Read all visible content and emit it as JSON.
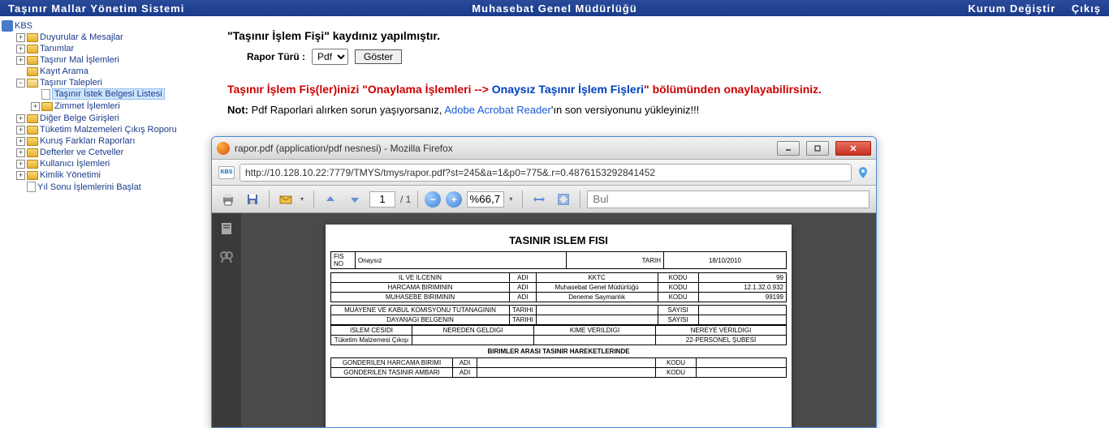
{
  "topbar": {
    "left": "Taşınır Mallar Yönetim Sistemi",
    "center": "Muhasebat Genel Müdürlüğü",
    "change_inst": "Kurum Değiştir",
    "logout": "Çıkış"
  },
  "tree": {
    "root": "KBS",
    "items": [
      "Duyurular & Mesajlar",
      "Tanımlar",
      "Taşınır Mal İşlemleri",
      "Kayıt Arama",
      "Taşınır Talepleri",
      "Diğer Belge Girişleri",
      "Tüketim Malzemeleri Çıkış Roporu",
      "Kuruş Farkları Raporları",
      "Defterler ve Cetveller",
      "Kullanıcı İşlemleri",
      "Kimlik Yönetimi",
      "Yıl Sonu İşlemlerini Başlat"
    ],
    "sub_talepleri": [
      "Taşınır İstek Belgesi Listesi",
      "Zimmet İşlemleri"
    ]
  },
  "content": {
    "saved_msg": "\"Taşınır İşlem Fişi\" kaydınız yapılmıştır.",
    "report_type_label": "Rapor Türü :",
    "report_type_value": "Pdf",
    "show_btn": "Göster",
    "line2_red1": "Taşınır İşlem Fiş(ler)inizi \"Onaylama İşlemleri --> ",
    "line2_blue": "Onaysız Taşınır İşlem Fişleri",
    "line2_red2": "\" bölümünden onaylayabilirsiniz.",
    "note_bold": "Not:",
    "note_text1": " Pdf Raporlari alırken sorun yaşıyorsanız, ",
    "note_link": "Adobe Acrobat Reader",
    "note_text2": "'ın son versiyonunu yükleyiniz!!!"
  },
  "popup": {
    "title": "rapor.pdf (application/pdf nesnesi) - Mozilla Firefox",
    "url": "http://10.128.10.22:7779/TMYS/tmys/rapor.pdf?st=245&a=1&p0=775&.r=0.4876153292841452",
    "favicon_text": "KBS",
    "page_current": "1",
    "page_total": "/ 1",
    "zoom": "%66,7",
    "find_placeholder": "Bul"
  },
  "pdf": {
    "title": "TASINIR ISLEM FISI",
    "r1": {
      "fisno_lab": "FIS NO",
      "fisno_val": "Onaysız",
      "tarih_lab": "TARIH",
      "tarih_val": "18/10/2010"
    },
    "r2": {
      "c1": "IL VE ILCENIN",
      "c2": "ADI",
      "c3": "KKTC",
      "c4": "KODU",
      "c5": "99"
    },
    "r3": {
      "c1": "HARCAMA BIRIMININ",
      "c2": "ADI",
      "c3": "Muhasebat Genel Müdürlüğü",
      "c4": "KODU",
      "c5": "12.1.32.0.932"
    },
    "r4": {
      "c1": "MUHASEBE BIRIMININ",
      "c2": "ADI",
      "c3": "Deneme Saymanlık",
      "c4": "KODU",
      "c5": "99199"
    },
    "r5": {
      "c1": "MUAYENE VE KABUL KOMISYONU TUTANAGININ",
      "c2": "TARIHI",
      "c3": "",
      "c4": "SAYISI",
      "c5": ""
    },
    "r6": {
      "c1": "DAYANAGI BELGENIN",
      "c2": "TARIHI",
      "c3": "",
      "c4": "SAYISI",
      "c5": ""
    },
    "r7": {
      "c1": "ISLEM CESIDI",
      "c2": "NEREDEN GELDIGI",
      "c3": "KIME VERILDIGI",
      "c4": "NEREYE VERILDIGI"
    },
    "r8": {
      "c1": "Tüketim Malzemesi Çıkışı",
      "c2": "",
      "c3": "",
      "c4": "22-PERSONEL ŞUBESİ"
    },
    "sec": "BIRIMLER ARASI TASINIR HAREKETLERINDE",
    "r9": {
      "c1": "GONDERILEN HARCAMA BIRIMI",
      "c2": "ADI",
      "c3": "",
      "c4": "KODU",
      "c5": ""
    },
    "r10": {
      "c1": "GONDERILEN TASINIR AMBARI",
      "c2": "ADI",
      "c3": "",
      "c4": "KODU",
      "c5": ""
    }
  }
}
